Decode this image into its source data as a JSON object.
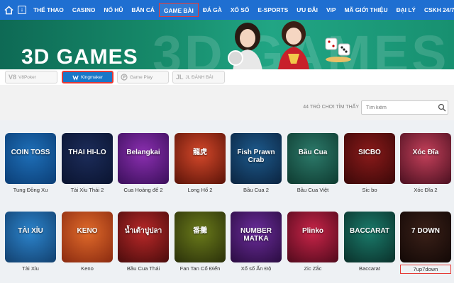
{
  "nav": {
    "items": [
      "THỂ THAO",
      "CASINO",
      "NỔ HŨ",
      "BẮN CÁ",
      "GAME BÀI",
      "ĐÁ GÀ",
      "XỔ SỐ",
      "E-SPORTS",
      "ƯU ĐÃI",
      "VIP",
      "MÃ GIỚI THIỆU",
      "ĐẠI LÝ",
      "CSKH 24/7"
    ],
    "active": "GAME BÀI",
    "colors": {
      "bar": "#1f6fd1",
      "active_border": "#e53935"
    }
  },
  "banner": {
    "title": "3D GAMES",
    "ghost_text": "3D GAMES"
  },
  "providers": [
    {
      "logo": "V8",
      "label": "V8Poker"
    },
    {
      "logo": "",
      "label": "Kingmaker",
      "active": true
    },
    {
      "logo": "",
      "label": "Game Play"
    },
    {
      "logo": "JL",
      "label": "JL ĐÁNH BÀI"
    }
  ],
  "results": {
    "count_text": "44 TRÒ CHƠI TÌM THẤY",
    "search_placeholder": "Tìm kiếm"
  },
  "games": [
    {
      "name": "Tung Đồng Xu",
      "art": "COIN TOSS",
      "c1": "#1e6fb8",
      "c2": "#0b3e76"
    },
    {
      "name": "Tài Xỉu Thái 2",
      "art": "THAI HI-LO",
      "c1": "#1c2c5a",
      "c2": "#0a1430"
    },
    {
      "name": "Cua Hoàng đế 2",
      "art": "Belangkai",
      "c1": "#8b2fb0",
      "c2": "#3a0f5a"
    },
    {
      "name": "Long Hổ 2",
      "art": "龍虎",
      "c1": "#d4482a",
      "c2": "#5a1308"
    },
    {
      "name": "Bầu Cua 2",
      "art": "Fish Prawn Crab",
      "c1": "#1d5a8c",
      "c2": "#0b2440"
    },
    {
      "name": "Bầu Cua Việt",
      "art": "Bầu Cua",
      "c1": "#2c7a6a",
      "c2": "#0e3a30"
    },
    {
      "name": "Sic bo",
      "art": "SICBO",
      "c1": "#8a1a1a",
      "c2": "#3a0808"
    },
    {
      "name": "Xóc Đĩa 2",
      "art": "Xóc Đĩa",
      "c1": "#c4405a",
      "c2": "#4a1020"
    },
    {
      "name": "Tài Xỉu",
      "art": "TÀI XỈU",
      "c1": "#2c84cc",
      "c2": "#12406e"
    },
    {
      "name": "Keno",
      "art": "KENO",
      "c1": "#e06a2a",
      "c2": "#8a2a10"
    },
    {
      "name": "Bầu Cua Thái",
      "art": "น้ำเต้าปูปลา",
      "c1": "#b82828",
      "c2": "#4a0c0c"
    },
    {
      "name": "Fan Tan Cổ Điển",
      "art": "番攤",
      "c1": "#6a7a1a",
      "c2": "#2a300a"
    },
    {
      "name": "Xổ số Ấn Độ",
      "art": "NUMBER MATKA",
      "c1": "#6a2c9a",
      "c2": "#2a0c40"
    },
    {
      "name": "Zic Zắc",
      "art": "Plinko",
      "c1": "#c82448",
      "c2": "#500a1c"
    },
    {
      "name": "Baccarat",
      "art": "BACCARAT",
      "c1": "#1a7a6a",
      "c2": "#0a302a"
    },
    {
      "name": "7up7down",
      "art": "7 DOWN",
      "c1": "#3a2018",
      "c2": "#120806",
      "highlight": true
    }
  ]
}
